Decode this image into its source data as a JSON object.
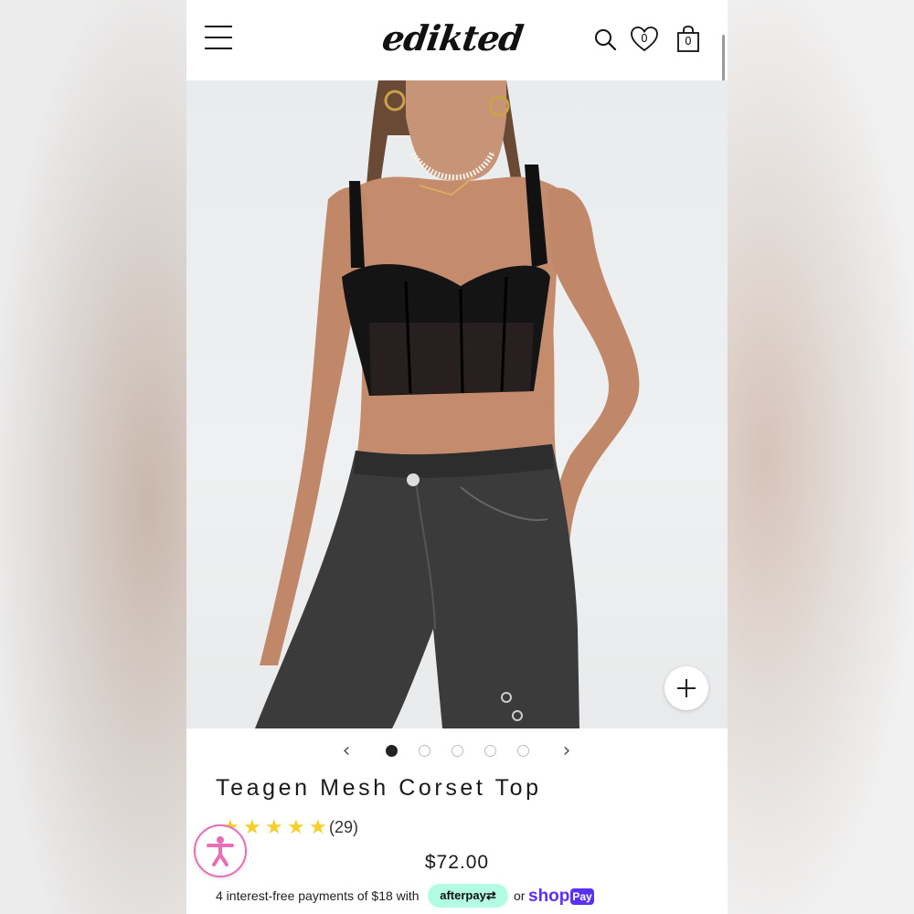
{
  "header": {
    "brand_logo": "edikted",
    "wishlist_count": "0",
    "bag_count": "0"
  },
  "hero": {
    "image_description": "model wearing black mesh corset top and washed black jeans",
    "zoom_icon": "plus-icon"
  },
  "carousel": {
    "prev_icon": "chevron-left-icon",
    "next_icon": "chevron-right-icon",
    "active_index": 0,
    "total_slides": 5
  },
  "product": {
    "title": "Teagen Mesh Corset Top",
    "rating_stars": 5,
    "rating_count": "(29)",
    "price": "$72.00"
  },
  "payment": {
    "installment_text": "4 interest-free payments of $18 with",
    "afterpay_label": "afterpay",
    "or_label": "or",
    "shop_label": "shop",
    "pay_label": "Pay"
  },
  "colors": {
    "star": "#f6cf2a",
    "afterpay_bg": "#b2fce4",
    "shoppay": "#5a31f4",
    "accessibility": "#e86fb6"
  }
}
